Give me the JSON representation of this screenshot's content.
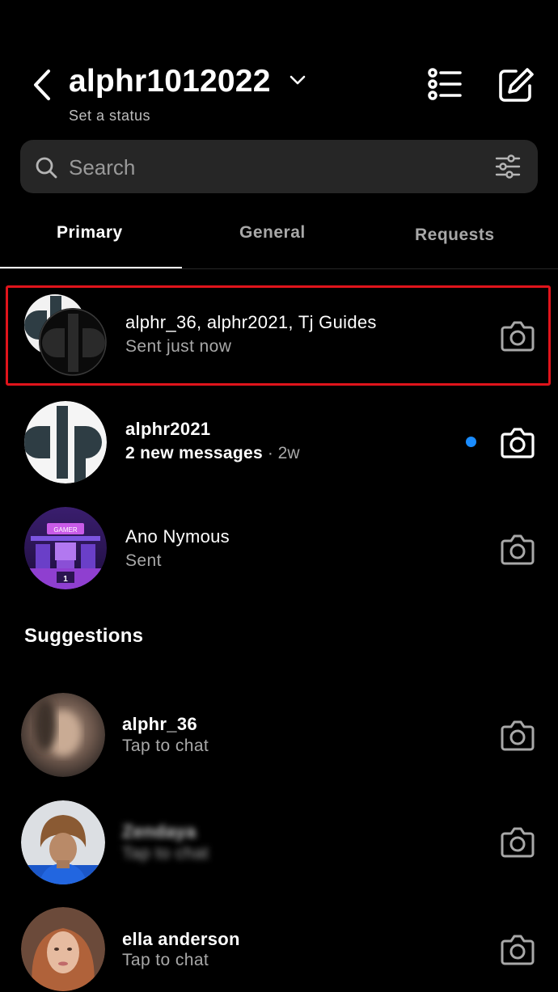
{
  "header": {
    "account_name": "alphr1012022",
    "status_text": "Set a status"
  },
  "search": {
    "placeholder": "Search"
  },
  "tabs": [
    {
      "label": "Primary",
      "active": true
    },
    {
      "label": "General",
      "active": false
    },
    {
      "label": "Requests",
      "active": false
    }
  ],
  "threads": [
    {
      "name": "alphr_36, alphr2021, Tj Guides",
      "subtitle": "Sent just now",
      "highlighted": true
    },
    {
      "name": "alphr2021",
      "subtitle": "2 new messages",
      "time": "· 2w",
      "unread": true
    },
    {
      "name": "Ano Nymous",
      "subtitle": "Sent"
    }
  ],
  "suggestions_heading": "Suggestions",
  "suggestions": [
    {
      "name": "alphr_36",
      "subtitle": "Tap to chat"
    },
    {
      "name": "Zendaya",
      "subtitle": "Tap to chat",
      "blurred": true
    },
    {
      "name": "ella anderson",
      "subtitle": "Tap to chat"
    }
  ],
  "colors": {
    "background": "#000000",
    "search_bg": "#262626",
    "highlight_border": "#e0141b",
    "unread_dot": "#1a8cff"
  }
}
